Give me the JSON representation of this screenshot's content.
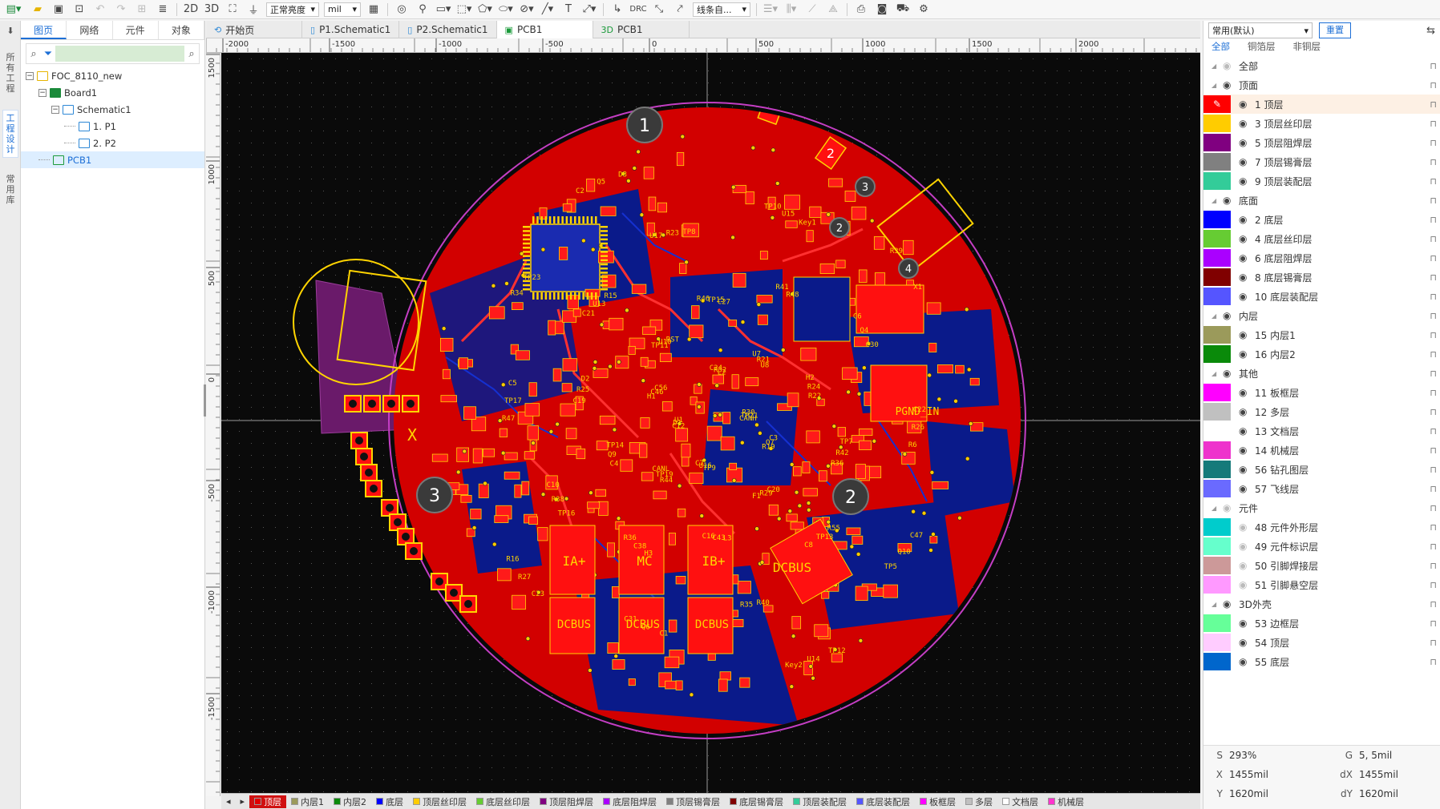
{
  "toolbar": {
    "view_2d": "2D",
    "view_3d": "3D",
    "brightness": "正常亮度",
    "unit": "mil",
    "drc": "DRC",
    "route_mode": "线条自..."
  },
  "vtabs": [
    "所有工程",
    "工程设计",
    "常用库"
  ],
  "left_panel": {
    "tabs": [
      "图页",
      "网络",
      "元件",
      "对象"
    ],
    "tree": [
      {
        "label": "FOC_8110_new",
        "level": 0,
        "icon": "folder-icon"
      },
      {
        "label": "Board1",
        "level": 1,
        "icon": "board-icon"
      },
      {
        "label": "Schematic1",
        "level": 2,
        "icon": "schematic-icon"
      },
      {
        "label": "1. P1",
        "level": 3,
        "icon": "page-icon"
      },
      {
        "label": "2. P2",
        "level": 3,
        "icon": "page-icon"
      },
      {
        "label": "PCB1",
        "level": 1,
        "icon": "pcb-icon",
        "selected": true
      }
    ]
  },
  "doc_tabs": [
    {
      "label": "开始页",
      "icon": "home"
    },
    {
      "label": "P1.Schematic1",
      "icon": "schematic"
    },
    {
      "label": "P2.Schematic1",
      "icon": "schematic"
    },
    {
      "label": "PCB1",
      "icon": "pcb",
      "active": true
    },
    {
      "label": "PCB1",
      "icon": "3d",
      "prefix": "3D"
    }
  ],
  "ruler_top": [
    "-2000",
    "-1500",
    "-1000",
    "-500",
    "0",
    "500",
    "1000",
    "1500",
    "2000"
  ],
  "ruler_left": [
    "1500",
    "1000",
    "500",
    "0",
    "-500",
    "-1000",
    "-1500"
  ],
  "bottom_tabs": [
    {
      "label": "顶层",
      "color": "#e00000",
      "active": true
    },
    {
      "label": "内层1",
      "color": "#9b9a5b"
    },
    {
      "label": "内层2",
      "color": "#0a8a0a"
    },
    {
      "label": "底层",
      "color": "#0000ff"
    },
    {
      "label": "顶层丝印层",
      "color": "#ffcc00"
    },
    {
      "label": "底层丝印层",
      "color": "#66cc33"
    },
    {
      "label": "顶层阻焊层",
      "color": "#800080"
    },
    {
      "label": "底层阻焊层",
      "color": "#aa00ff"
    },
    {
      "label": "顶层锡膏层",
      "color": "#808080"
    },
    {
      "label": "底层锡膏层",
      "color": "#800000"
    },
    {
      "label": "顶层装配层",
      "color": "#33cc99"
    },
    {
      "label": "底层装配层",
      "color": "#5555ff"
    },
    {
      "label": "板框层",
      "color": "#ff00ff"
    },
    {
      "label": "多层",
      "color": "#c0c0c0"
    },
    {
      "label": "文档层",
      "color": "#ffffff"
    },
    {
      "label": "机械层",
      "color": "#ff33cc"
    }
  ],
  "right_panel": {
    "preset": "常用(默认)",
    "reset": "重置",
    "tabs": [
      "全部",
      "铜箔层",
      "非铜层"
    ],
    "rows": [
      {
        "type": "group",
        "label": "全部",
        "eye": false
      },
      {
        "type": "group",
        "label": "顶面",
        "eye": true
      },
      {
        "type": "layer",
        "label": "1 顶层",
        "color": "#ff0000",
        "selected": true,
        "active": true
      },
      {
        "type": "layer",
        "label": "3 顶层丝印层",
        "color": "#ffcc00"
      },
      {
        "type": "layer",
        "label": "5 顶层阻焊层",
        "color": "#800080"
      },
      {
        "type": "layer",
        "label": "7 顶层锡膏层",
        "color": "#808080"
      },
      {
        "type": "layer",
        "label": "9 顶层装配层",
        "color": "#33cc99"
      },
      {
        "type": "group",
        "label": "底面",
        "eye": true
      },
      {
        "type": "layer",
        "label": "2 底层",
        "color": "#0000ff"
      },
      {
        "type": "layer",
        "label": "4 底层丝印层",
        "color": "#66cc33"
      },
      {
        "type": "layer",
        "label": "6 底层阻焊层",
        "color": "#aa00ff"
      },
      {
        "type": "layer",
        "label": "8 底层锡膏层",
        "color": "#800000"
      },
      {
        "type": "layer",
        "label": "10 底层装配层",
        "color": "#5555ff"
      },
      {
        "type": "group",
        "label": "内层",
        "eye": true
      },
      {
        "type": "layer",
        "label": "15 内层1",
        "color": "#9b9a5b"
      },
      {
        "type": "layer",
        "label": "16 内层2",
        "color": "#0a8a0a"
      },
      {
        "type": "group",
        "label": "其他",
        "eye": true
      },
      {
        "type": "layer",
        "label": "11 板框层",
        "color": "#ff00ff"
      },
      {
        "type": "layer",
        "label": "12 多层",
        "color": "#c0c0c0"
      },
      {
        "type": "layer",
        "label": "13 文档层",
        "color": "#ffffff"
      },
      {
        "type": "layer",
        "label": "14 机械层",
        "color": "#ee33cc"
      },
      {
        "type": "layer",
        "label": "56 钻孔图层",
        "color": "#157a7a"
      },
      {
        "type": "layer",
        "label": "57 飞线层",
        "color": "#6a6aff"
      },
      {
        "type": "group",
        "label": "元件",
        "eye": false
      },
      {
        "type": "layer",
        "label": "48 元件外形层",
        "color": "#00cccc",
        "eye": false
      },
      {
        "type": "layer",
        "label": "49 元件标识层",
        "color": "#66ffcc",
        "eye": false
      },
      {
        "type": "layer",
        "label": "50 引脚焊接层",
        "color": "#cc9999",
        "eye": false
      },
      {
        "type": "layer",
        "label": "51 引脚悬空层",
        "color": "#ff99ff",
        "eye": false
      },
      {
        "type": "group",
        "label": "3D外壳",
        "eye": true
      },
      {
        "type": "layer",
        "label": "53 边框层",
        "color": "#66ff99"
      },
      {
        "type": "layer",
        "label": "54 顶层",
        "color": "#ffccff"
      },
      {
        "type": "layer",
        "label": "55 底层",
        "color": "#0066cc"
      }
    ],
    "status": {
      "S": "293%",
      "G": "5, 5mil",
      "X": "1455mil",
      "dX": "1455mil",
      "Y": "1620mil",
      "dY": "1620mil"
    }
  },
  "pcb": {
    "silk_labels": [
      "CANH",
      "CANL",
      "C27",
      "C8",
      "C5",
      "X1",
      "C7",
      "RST",
      "R36",
      "C10",
      "Key1",
      "Key2",
      "C56",
      "R22",
      "R36",
      "TP8",
      "TP5",
      "U1",
      "U8",
      "C16",
      "R15",
      "R6",
      "R16",
      "L2",
      "F1",
      "D2",
      "C30",
      "C31",
      "D3",
      "R19",
      "TP14",
      "R48",
      "R35",
      "TP23",
      "TP21",
      "TP19",
      "TP15",
      "TP13",
      "TP17",
      "C28",
      "U16",
      "U10",
      "R42",
      "R38",
      "U15",
      "U14",
      "C46",
      "R24",
      "C38",
      "R23",
      "Q10",
      "D1",
      "R21",
      "C43",
      "U13",
      "R26",
      "R27",
      "R32",
      "R29",
      "R25",
      "Q4",
      "Q6",
      "Q5",
      "Q7",
      "Q9",
      "R41",
      "R40",
      "R34",
      "R30",
      "R44",
      "R46",
      "R55",
      "R47",
      "R39",
      "TP9",
      "TP11",
      "TP7",
      "TP16",
      "TP10",
      "TP12",
      "H1",
      "H2",
      "H3",
      "U17",
      "C47",
      "C12",
      "U7",
      "L3",
      "C21",
      "C22",
      "C23",
      "C24",
      "C20",
      "C19",
      "C6",
      "C1",
      "C2",
      "C3",
      "C4"
    ],
    "big_labels": [
      "IA+",
      "MC",
      "IB+",
      "DCBUS",
      "DCBUS",
      "DCBUS",
      "DCBUS",
      "PGND_IN",
      "X"
    ],
    "hole_numbers": [
      "1",
      "2",
      "3",
      "3",
      "2",
      "4"
    ],
    "pad_numbers": [
      "5",
      "6",
      "5",
      "6",
      "2",
      "1",
      "2",
      "8",
      "8",
      "8",
      "8",
      "8",
      "8",
      "2"
    ]
  }
}
